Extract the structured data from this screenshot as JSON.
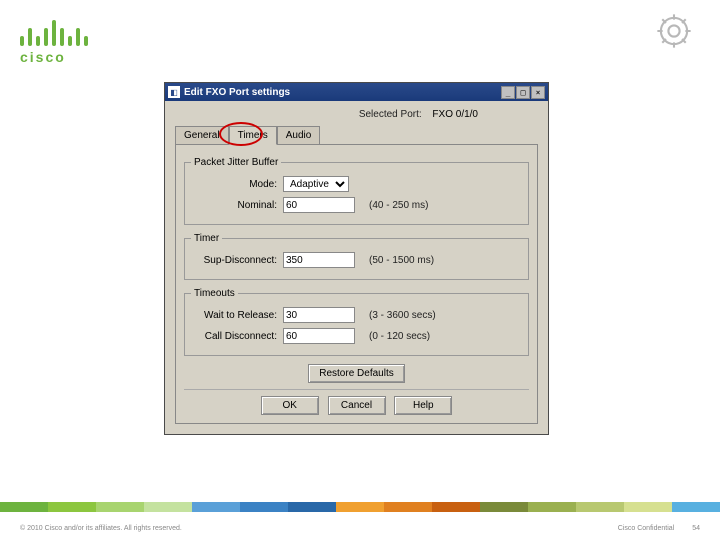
{
  "logo_text": "cisco",
  "dialog": {
    "title": "Edit FXO Port settings",
    "selected_port_label": "Selected Port:",
    "selected_port_value": "FXO 0/1/0",
    "tabs": {
      "general": "General",
      "timers": "Timers",
      "audio": "Audio"
    },
    "groups": {
      "jitter": {
        "legend": "Packet Jitter Buffer",
        "mode_label": "Mode:",
        "mode_value": "Adaptive",
        "nominal_label": "Nominal:",
        "nominal_value": "60",
        "nominal_range": "(40 - 250 ms)"
      },
      "timer": {
        "legend": "Timer",
        "sup_label": "Sup-Disconnect:",
        "sup_value": "350",
        "sup_range": "(50 - 1500 ms)"
      },
      "timeouts": {
        "legend": "Timeouts",
        "wait_label": "Wait to Release:",
        "wait_value": "30",
        "wait_range": "(3 - 3600 secs)",
        "call_label": "Call Disconnect:",
        "call_value": "60",
        "call_range": "(0 - 120 secs)"
      }
    },
    "buttons": {
      "restore": "Restore Defaults",
      "ok": "OK",
      "cancel": "Cancel",
      "help": "Help"
    }
  },
  "footer": {
    "copyright": "© 2010 Cisco and/or its affiliates. All rights reserved.",
    "confidential": "Cisco Confidential",
    "page_no": "54"
  },
  "strip_colors": [
    "#6db33f",
    "#8cc63f",
    "#a8d46f",
    "#c4e29f",
    "#5aa0d8",
    "#3b82c4",
    "#2968a8",
    "#f0a030",
    "#e08020",
    "#c86010",
    "#7a8a3a",
    "#9ab050",
    "#b8c870",
    "#d6e090",
    "#58b0e0"
  ]
}
